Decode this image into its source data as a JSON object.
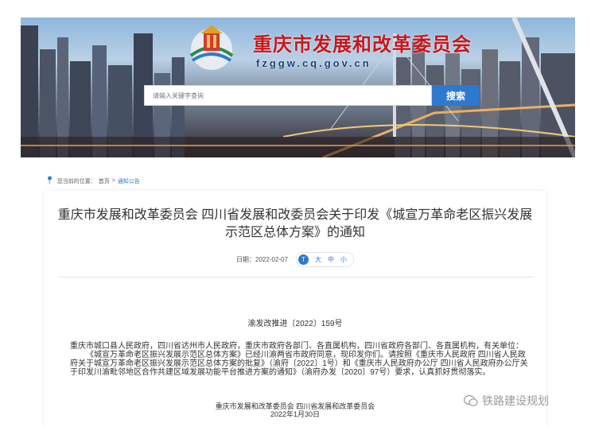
{
  "header": {
    "site_title": "重庆市发展和改革委员会",
    "site_domain": "fzggw.cq.gov.cn",
    "search_placeholder": "请输入关键字查询",
    "search_button": "搜索"
  },
  "breadcrumb": {
    "prefix": "您当前的位置：",
    "home": "首页",
    "separator": ">",
    "current": "通知公告"
  },
  "article": {
    "title_line1": "重庆市发展和改革委员会 四川省发展和改委员会关于印发《城宣万革命老区振兴发展",
    "title_line2": "示范区总体方案》的通知",
    "date_label": "日期：2022-02-07",
    "font_sizes": {
      "large": "大",
      "medium": "中",
      "small": "小"
    },
    "doc_number": "渝发改推进〔2022〕159号",
    "recipients": "重庆市城口县人民政府，四川省达州市人民政府，重庆市政府各部门、各直属机构，四川省政府各部门、各直属机构，有关单位：",
    "body": "《城宣万革命老区振兴发展示范区总体方案》已经川渝两省市政府同意，现印发你们。请按照《重庆市人民政府 四川省人民政府关于城宣万革命老区振兴发展示范区总体方案的批复》（渝府〔2022〕1号）和《重庆市人民政府办公厅 四川省人民政府办公厅关于印发川渝毗邻地区合作共建区域发展功能平台推进方案的通知》（渝府办发〔2020〕97号）要求，认真抓好贯彻落实。",
    "signature_line1": "重庆市发展和改革委员会 四川省发展和改革委员会",
    "signature_line2": "2022年1月30日"
  },
  "watermark": "铁路建设规划",
  "colors": {
    "accent": "#2f78d0",
    "brand_red": "#c5171d"
  },
  "icons": [
    "location-pin-icon",
    "font-size-icon",
    "wechat-icon",
    "government-logo-icon"
  ]
}
